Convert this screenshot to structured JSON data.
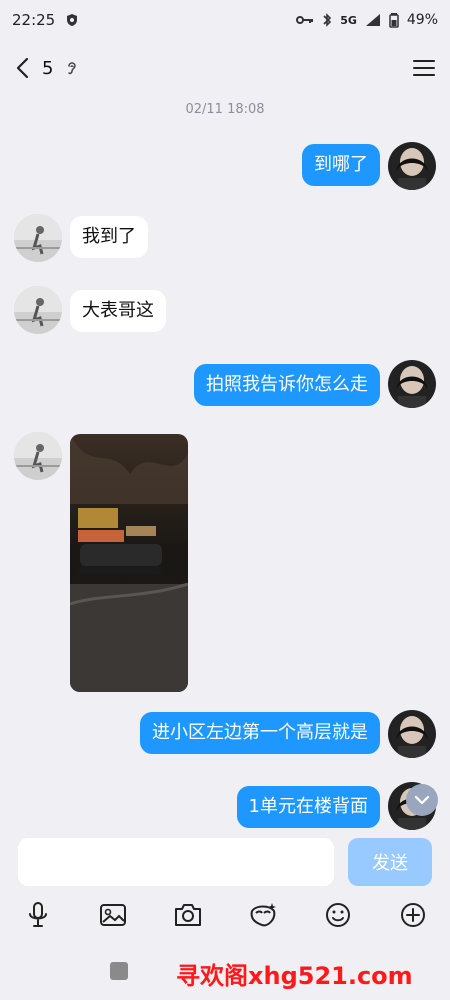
{
  "status": {
    "time": "22:25",
    "network": "5G",
    "battery": "49%"
  },
  "header": {
    "count": "5"
  },
  "chat": {
    "timestamp": "02/11 18:08",
    "messages": [
      {
        "side": "right",
        "text": "到哪了"
      },
      {
        "side": "left",
        "text": "我到了"
      },
      {
        "side": "left",
        "text": "大表哥这"
      },
      {
        "side": "right",
        "text": "拍照我告诉你怎么走"
      },
      {
        "side": "right",
        "text": "进小区左边第一个高层就是"
      },
      {
        "side": "right",
        "text": "1单元在楼背面"
      }
    ]
  },
  "input": {
    "placeholder": "",
    "send_label": "发送"
  },
  "toolbar": {
    "icons": [
      "mic-icon",
      "image-icon",
      "camera-icon",
      "sticker-icon",
      "emoji-icon",
      "plus-icon"
    ]
  },
  "watermark": "寻欢阁xhg521.com"
}
